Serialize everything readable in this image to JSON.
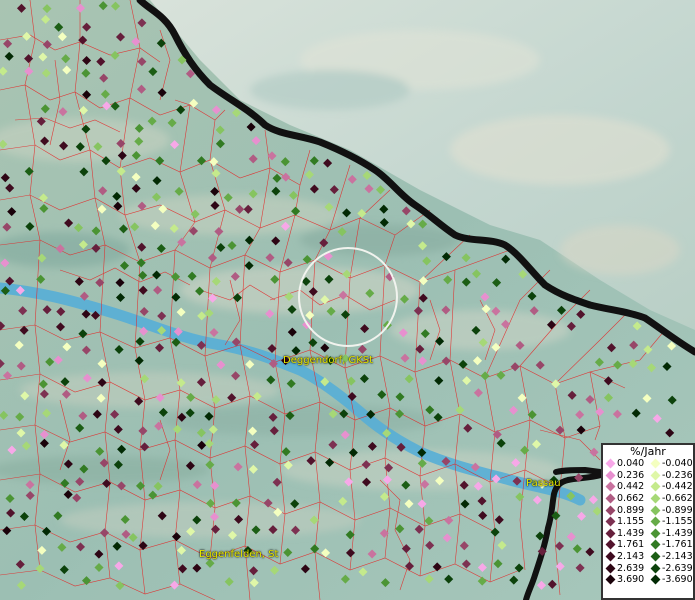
{
  "map": {
    "places": [
      {
        "name": "Deggendorf, GKSt",
        "key": "deggendorf"
      },
      {
        "name": "Passau",
        "key": "passau"
      },
      {
        "name": "Eggenfelden, St",
        "key": "eggenfelden"
      }
    ]
  },
  "legend": {
    "title": "%/Jahr",
    "positive": [
      {
        "label": "0.040",
        "color": "#f7a8e8"
      },
      {
        "label": "0.236",
        "color": "#e790cf"
      },
      {
        "label": "0.442",
        "color": "#c9739f"
      },
      {
        "label": "0.662",
        "color": "#b05c83"
      },
      {
        "label": "0.899",
        "color": "#974668"
      },
      {
        "label": "1.155",
        "color": "#7d3152"
      },
      {
        "label": "1.439",
        "color": "#661f3c"
      },
      {
        "label": "1.761",
        "color": "#52132c"
      },
      {
        "label": "2.143",
        "color": "#3f0b1f"
      },
      {
        "label": "2.639",
        "color": "#2d0514"
      },
      {
        "label": "3.690",
        "color": "#1a020a"
      }
    ],
    "negative": [
      {
        "label": "-0.040",
        "color": "#f4ffc0"
      },
      {
        "label": "-0.236",
        "color": "#dff7a8"
      },
      {
        "label": "-0.442",
        "color": "#c4ea8c"
      },
      {
        "label": "-0.662",
        "color": "#a6d877"
      },
      {
        "label": "-0.899",
        "color": "#86c460"
      },
      {
        "label": "-1.155",
        "color": "#66ab48"
      },
      {
        "label": "-1.439",
        "color": "#4b9434"
      },
      {
        "label": "-1.761",
        "color": "#317a22"
      },
      {
        "label": "-2.143",
        "color": "#1c5e15"
      },
      {
        "label": "-2.639",
        "color": "#0c420b"
      },
      {
        "label": "-3.690",
        "color": "#022a04"
      }
    ]
  },
  "colors": {
    "river": "#5fb0d8",
    "boundary": "#e52222",
    "border": "#111111",
    "terrain_low": "#9fc2b4",
    "terrain_high": "#c9d6cc"
  }
}
